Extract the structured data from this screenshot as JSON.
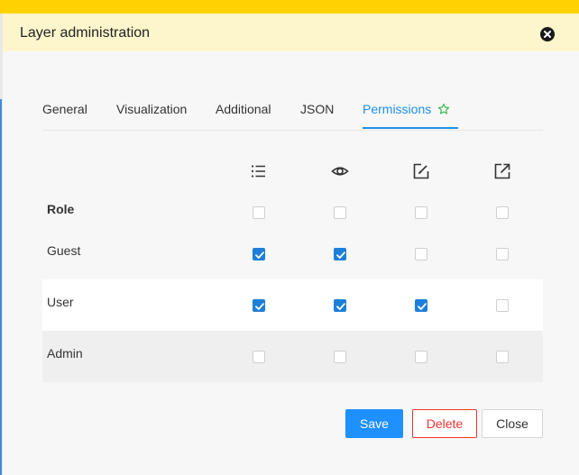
{
  "dialog": {
    "title": "Layer administration"
  },
  "tabs": [
    {
      "label": "General"
    },
    {
      "label": "Visualization"
    },
    {
      "label": "Additional"
    },
    {
      "label": "JSON"
    },
    {
      "label": "Permissions"
    }
  ],
  "active_tab": "Permissions",
  "permission_columns": [
    {
      "icon": "list-icon"
    },
    {
      "icon": "eye-icon"
    },
    {
      "icon": "edit-icon"
    },
    {
      "icon": "publish-icon"
    }
  ],
  "table": {
    "header_label": "Role",
    "rows": [
      {
        "label": "Guest",
        "checks": [
          true,
          true,
          false,
          false
        ]
      },
      {
        "label": "User",
        "checks": [
          true,
          true,
          true,
          false
        ]
      },
      {
        "label": "Admin",
        "checks": [
          false,
          false,
          false,
          false
        ]
      }
    ]
  },
  "buttons": {
    "save": "Save",
    "delete": "Delete",
    "close": "Close"
  },
  "colors": {
    "accent": "#1e90e8",
    "top_bar": "#ffd200",
    "header_bg": "#fdf6cc",
    "delete": "#ee3333",
    "star": "#3cb84a"
  }
}
